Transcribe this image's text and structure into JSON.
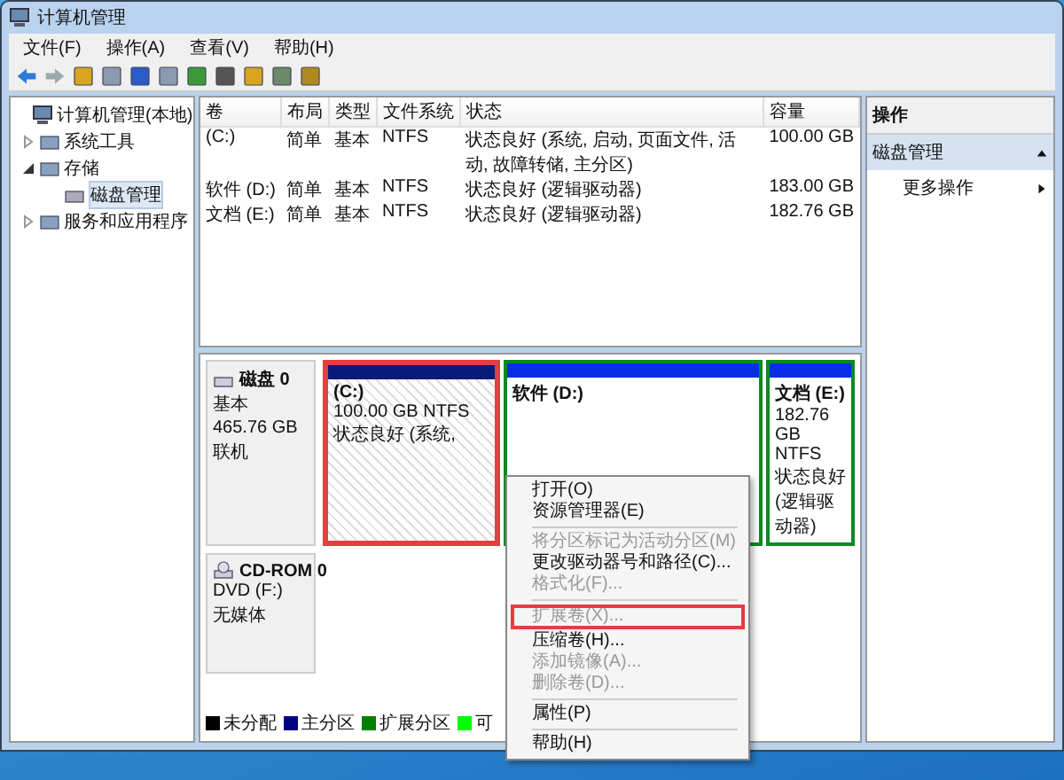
{
  "window": {
    "title": "计算机管理"
  },
  "menu_bar": [
    "文件(F)",
    "操作(A)",
    "查看(V)",
    "帮助(H)"
  ],
  "tree": [
    {
      "label": "计算机管理(本地)",
      "selected": false,
      "children": [
        {
          "label": "系统工具",
          "expanded": false,
          "selected": false
        },
        {
          "label": "存储",
          "expanded": true,
          "selected": false,
          "children": [
            {
              "label": "磁盘管理",
              "selected": true
            }
          ]
        },
        {
          "label": "服务和应用程序",
          "expanded": false,
          "selected": false
        }
      ]
    }
  ],
  "table": {
    "columns": [
      "卷",
      "布局",
      "类型",
      "文件系统",
      "状态",
      "容量"
    ],
    "rows": [
      {
        "cells": [
          "(C:)",
          "简单",
          "基本",
          "NTFS",
          "状态良好 (系统, 启动, 页面文件, 活动, 故障转储, 主分区)",
          "100.00 GB"
        ]
      },
      {
        "cells": [
          "软件 (D:)",
          "简单",
          "基本",
          "NTFS",
          "状态良好 (逻辑驱动器)",
          "183.00 GB"
        ]
      },
      {
        "cells": [
          "文档 (E:)",
          "简单",
          "基本",
          "NTFS",
          "状态良好 (逻辑驱动器)",
          "182.76 GB"
        ]
      }
    ]
  },
  "actions": {
    "title": "操作",
    "section": {
      "label": "磁盘管理",
      "expanded": true
    },
    "items": [
      {
        "label": "更多操作"
      }
    ]
  },
  "disks": [
    {
      "kind": "hdd",
      "name": "磁盘 0",
      "lines": [
        "基本",
        "465.76 GB",
        "联机"
      ],
      "partitions": [
        {
          "color": "#0a1a7a",
          "label": "(C:)",
          "lines": [
            "100.00 GB NTFS",
            "状态良好 (系统,"
          ],
          "selected": true,
          "highlighted": true
        },
        {
          "color": "#0a2ee8",
          "label": "软件 (D:)",
          "selected": false,
          "highlighted": false
        },
        {
          "color": "#0a2ee8",
          "label": "文档 (E:)",
          "lines": [
            "182.76 GB NTFS",
            "状态良好 (逻辑驱动器)"
          ],
          "selected": false,
          "highlighted": false
        }
      ]
    },
    {
      "kind": "cdrom",
      "name": "CD-ROM 0",
      "lines": [
        "DVD (F:)",
        "无媒体"
      ]
    }
  ],
  "legend": [
    {
      "label": "未分配",
      "color": "#000000"
    },
    {
      "label": "主分区",
      "color": "#000080"
    },
    {
      "label": "扩展分区",
      "color": "#008000"
    },
    {
      "label": "可",
      "color": "#00ff00"
    }
  ],
  "context_menu": [
    {
      "kind": "item",
      "label": "打开(O)",
      "disabled": false,
      "highlighted": false
    },
    {
      "kind": "item",
      "label": "资源管理器(E)",
      "disabled": false,
      "highlighted": false
    },
    {
      "kind": "separator"
    },
    {
      "kind": "item",
      "label": "将分区标记为活动分区(M)",
      "disabled": true,
      "highlighted": false
    },
    {
      "kind": "item",
      "label": "更改驱动器号和路径(C)...",
      "disabled": false,
      "highlighted": false
    },
    {
      "kind": "item",
      "label": "格式化(F)...",
      "disabled": true,
      "highlighted": false
    },
    {
      "kind": "separator"
    },
    {
      "kind": "item",
      "label": "扩展卷(X)...",
      "disabled": true,
      "highlighted": true
    },
    {
      "kind": "item",
      "label": "压缩卷(H)...",
      "disabled": false,
      "highlighted": false
    },
    {
      "kind": "item",
      "label": "添加镜像(A)...",
      "disabled": true,
      "highlighted": false
    },
    {
      "kind": "item",
      "label": "删除卷(D)...",
      "disabled": true,
      "highlighted": false
    },
    {
      "kind": "separator"
    },
    {
      "kind": "item",
      "label": "属性(P)",
      "disabled": false,
      "highlighted": false
    },
    {
      "kind": "separator"
    },
    {
      "kind": "item",
      "label": "帮助(H)",
      "disabled": false,
      "highlighted": false
    }
  ]
}
